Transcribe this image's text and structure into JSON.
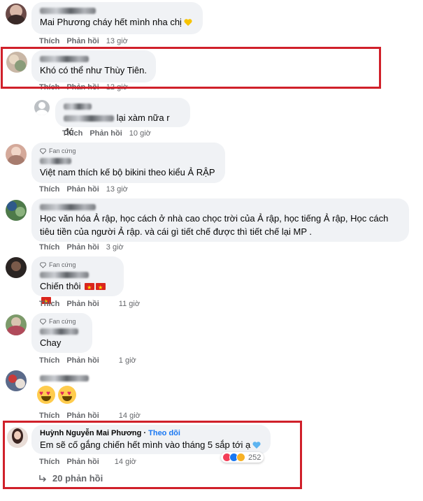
{
  "comments": [
    {
      "text": "Mai Phương cháy hết mình nha chị",
      "like": "Thích",
      "reply": "Phản hồi",
      "time": "13 giờ"
    },
    {
      "text": "Khó có thể như Thùy Tiên.",
      "like": "Thích",
      "reply": "Phản hồi",
      "time": "12 giờ"
    },
    {
      "text": "lại xàm nữa r đó",
      "like": "Thích",
      "reply": "Phản hồi",
      "time": "10 giờ"
    },
    {
      "badge": "Fan cứng",
      "text": "Việt nam thích kế bộ bikini theo kiểu Ả RẬP",
      "like": "Thích",
      "reply": "Phản hồi",
      "time": "13 giờ"
    },
    {
      "text_line1": "Học văn hóa Ả rập, học cách ở nhà cao chọc trời của Ả rập, học tiếng Ả rập, Học cách",
      "text_line2": "tiêu tiền của người Ả rập. và cái gì tiết chế được thì tiết chế lại MP .",
      "like": "Thích",
      "reply": "Phản hồi",
      "time": "3 giờ"
    },
    {
      "badge": "Fan cứng",
      "text": "Chiến thôi",
      "like": "Thích",
      "reply": "Phản hồi",
      "time": "11 giờ"
    },
    {
      "badge": "Fan cứng",
      "text": "Chay",
      "like": "Thích",
      "reply": "Phản hồi",
      "time": "1 giờ"
    },
    {
      "like": "Thích",
      "reply": "Phản hồi",
      "time": "14 giờ"
    },
    {
      "author": "Huỳnh Nguyễn Mai Phương",
      "follow": "Theo dõi",
      "text": "Em sẽ cố gắng chiến hết mình vào tháng 5 sắp tới ạ",
      "like": "Thích",
      "reply": "Phản hồi",
      "time": "14 giờ",
      "reaction_count": "252",
      "replies_label": "20 phản hồi"
    }
  ],
  "icons": {
    "heart_emoji": "yellow-heart-icon",
    "heart_blue": "blue-heart-icon",
    "flag": "vietnam-flag-icon",
    "gem": "diamond-icon",
    "reply_arrow": "reply-arrow-icon",
    "reactions": [
      "love-icon",
      "like-icon",
      "haha-icon"
    ]
  },
  "colors": {
    "bubble": "#f0f2f5",
    "meta": "#65676b",
    "highlight_box": "#d0202a",
    "follow_link": "#1877f2"
  }
}
